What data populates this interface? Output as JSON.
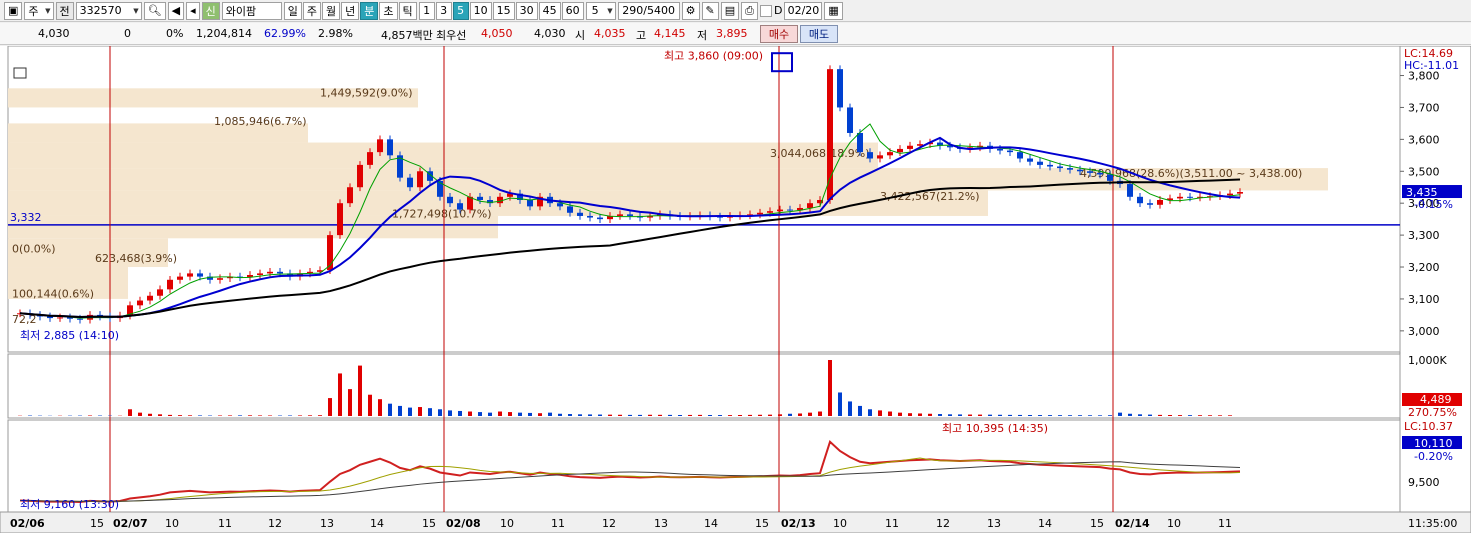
{
  "toolbar": {
    "market": "주",
    "prefix": "전",
    "code": "332570",
    "type_badge": "신",
    "name": "와이팜",
    "periods": [
      "일",
      "주",
      "월",
      "년",
      "분",
      "초",
      "틱"
    ],
    "intervals": [
      "1",
      "3",
      "5",
      "10",
      "15",
      "30",
      "45",
      "60"
    ],
    "interval_value": "5",
    "count": "290/5400",
    "checkbox_label": "D",
    "date": "02/20"
  },
  "info": {
    "price": "4,030",
    "change": "0",
    "change_pct": "0%",
    "volume": "1,204,814",
    "ratio1": "62.99%",
    "ratio2": "2.98%",
    "amount": "4,857백만",
    "bid_label": "최우선",
    "bid": "4,050",
    "ask": "4,030",
    "open_label": "시",
    "open": "4,035",
    "high_label": "고",
    "high": "4,145",
    "low_label": "저",
    "low": "3,895",
    "buy_label": "매수",
    "sell_label": "매도"
  },
  "chart_data": {
    "type": "candlestick",
    "x_ticks": [
      "02/06",
      "15",
      "02/07",
      "10",
      "11",
      "12",
      "13",
      "14",
      "15",
      "02/08",
      "10",
      "11",
      "12",
      "13",
      "14",
      "15",
      "02/13",
      "10",
      "11",
      "12",
      "13",
      "14",
      "15",
      "02/14",
      "10",
      "11"
    ],
    "x_date_ticks": [
      "02/06",
      "02/07",
      "02/08",
      "02/13",
      "02/14"
    ],
    "time_label": "11:35:00",
    "price_panel": {
      "y_ticks": [
        "3,800",
        "3,700",
        "3,600",
        "3,500",
        "3,400",
        "3,300",
        "3,200",
        "3,100",
        "3,000"
      ],
      "ylim": [
        2940,
        3880
      ],
      "lc_label": "LC:14.69",
      "hc_label": "HC:-11.01",
      "current_price": "3,435",
      "current_pct": "-0.15%",
      "ref_line_label": "3,332",
      "ref_line_value": 3332,
      "max_annotation": "최고 3,860 (09:00)",
      "min_annotation": "최저 2,885 (14:10)",
      "volume_profile_labels": [
        "1,449,592(9.0%)",
        "1,085,946(6.7%)",
        "3,044,068(18.9%)",
        "1,727,498(10.7%)",
        "3,422,567(21.2%)",
        "4,599,968(28.6%)(3,511.00 ~ 3,438.00)",
        "623,468(3.9%)",
        "100,144(0.6%)",
        "0(0.0%)",
        "72,2"
      ],
      "closes": [
        3055,
        3050,
        3045,
        3040,
        3042,
        3038,
        3035,
        3050,
        3045,
        3040,
        3048,
        3080,
        3095,
        3110,
        3130,
        3160,
        3170,
        3180,
        3170,
        3160,
        3165,
        3170,
        3168,
        3175,
        3180,
        3185,
        3180,
        3170,
        3180,
        3185,
        3190,
        3300,
        3400,
        3450,
        3520,
        3560,
        3600,
        3550,
        3480,
        3450,
        3500,
        3470,
        3420,
        3400,
        3380,
        3420,
        3410,
        3400,
        3420,
        3430,
        3410,
        3390,
        3420,
        3400,
        3390,
        3370,
        3360,
        3355,
        3350,
        3360,
        3365,
        3360,
        3355,
        3360,
        3365,
        3360,
        3358,
        3360,
        3362,
        3358,
        3355,
        3360,
        3362,
        3365,
        3370,
        3375,
        3380,
        3378,
        3385,
        3400,
        3410,
        3820,
        3700,
        3620,
        3560,
        3540,
        3550,
        3560,
        3570,
        3580,
        3585,
        3590,
        3580,
        3575,
        3570,
        3575,
        3580,
        3570,
        3565,
        3560,
        3540,
        3530,
        3520,
        3515,
        3510,
        3505,
        3500,
        3495,
        3490,
        3470,
        3460,
        3420,
        3400,
        3395,
        3410,
        3415,
        3420,
        3418,
        3420,
        3422,
        3425,
        3430,
        3435
      ]
    },
    "volume_panel": {
      "y_tick": "1,000K",
      "current": "4,489",
      "ratio": "270.75%",
      "values": [
        5,
        8,
        6,
        4,
        5,
        6,
        7,
        9,
        8,
        6,
        5,
        120,
        60,
        40,
        30,
        20,
        15,
        12,
        10,
        8,
        9,
        10,
        11,
        12,
        10,
        9,
        8,
        9,
        10,
        12,
        14,
        320,
        760,
        480,
        900,
        380,
        300,
        220,
        180,
        150,
        160,
        140,
        120,
        100,
        90,
        80,
        70,
        60,
        80,
        70,
        60,
        55,
        50,
        60,
        40,
        35,
        30,
        28,
        26,
        24,
        22,
        20,
        20,
        22,
        21,
        20,
        18,
        19,
        20,
        18,
        17,
        16,
        18,
        20,
        22,
        24,
        30,
        40,
        45,
        60,
        80,
        1000,
        420,
        260,
        180,
        120,
        100,
        80,
        60,
        50,
        45,
        40,
        35,
        30,
        28,
        26,
        25,
        24,
        22,
        20,
        19,
        18,
        17,
        16,
        15,
        14,
        14,
        13,
        12,
        14,
        60,
        40,
        30,
        25,
        20,
        18,
        16,
        15,
        14,
        13,
        12,
        12
      ]
    },
    "sub_panel": {
      "lc_label": "LC:10.37",
      "current": "10,110",
      "current_pct": "-0.20%",
      "y_tick": "9,500",
      "max_annotation": "최고 10,395 (14:35)",
      "min_annotation": "최저 9,160 (13:30)"
    }
  }
}
